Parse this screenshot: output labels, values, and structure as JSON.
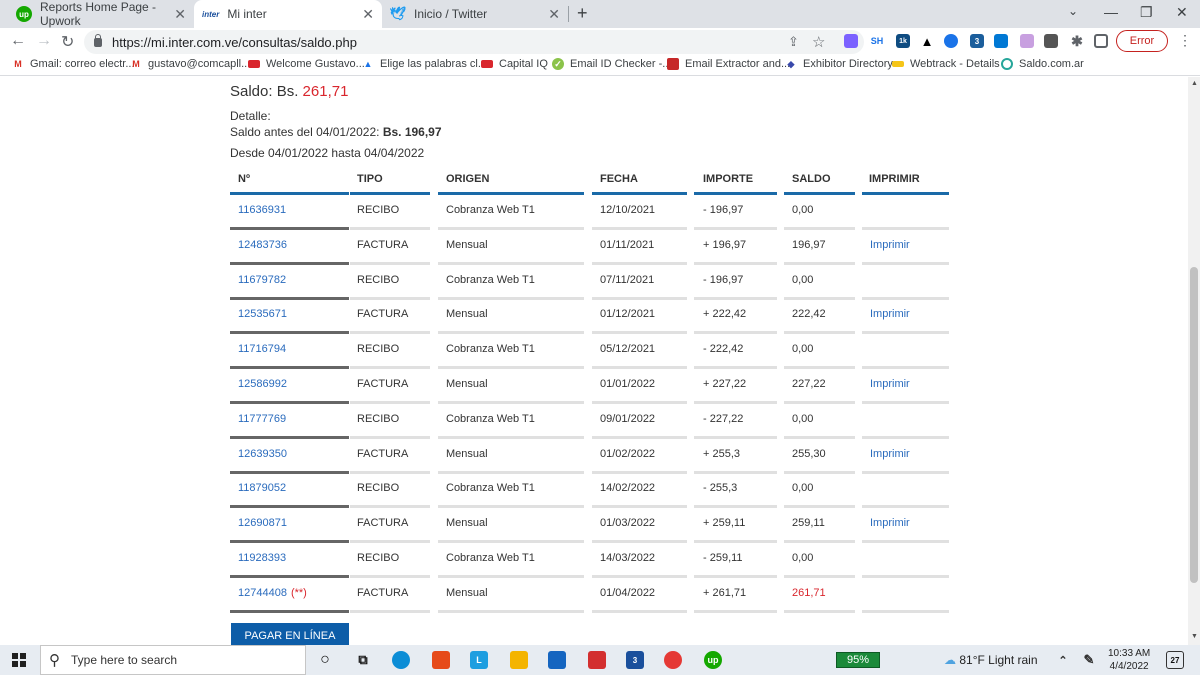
{
  "tabs": [
    {
      "title": "Reports Home Page - Upwork",
      "icon": "upwork-icon",
      "active": false
    },
    {
      "title": "Mi inter",
      "icon": "inter-icon",
      "active": true
    },
    {
      "title": "Inicio / Twitter",
      "icon": "twitter-icon",
      "active": false
    }
  ],
  "inter_favicon_text": "inter",
  "upwork_favicon_text": "up",
  "address": "https://mi.inter.com.ve/consultas/saldo.php",
  "toolbar": {
    "sh_label": "SH",
    "badge_1k": "1k",
    "badge_3": "3",
    "error_label": "Error"
  },
  "bookmarks": [
    {
      "label": "Gmail: correo electr...",
      "icon": "gmail-icon"
    },
    {
      "label": "gustavo@comcapll...",
      "icon": "gmail-icon"
    },
    {
      "label": "Welcome Gustavo...",
      "icon": "flag-icon"
    },
    {
      "label": "Elige las palabras cl...",
      "icon": "google-ads-icon"
    },
    {
      "label": "Capital IQ",
      "icon": "flag-icon"
    },
    {
      "label": "Email ID Checker -...",
      "icon": "checkmark-icon"
    },
    {
      "label": "Email Extractor and...",
      "icon": "extractor-icon"
    },
    {
      "label": "Exhibitor Directory",
      "icon": "exhibitor-icon"
    },
    {
      "label": "Webtrack - Details",
      "icon": "webtrack-icon"
    },
    {
      "label": "Saldo.com.ar",
      "icon": "saldo-icon"
    }
  ],
  "saldo": {
    "label": "Saldo: Bs.",
    "amount": "261,71"
  },
  "detalle_label": "Detalle:",
  "saldo_antes_label": "Saldo antes del 04/01/2022:",
  "saldo_antes_value": "Bs. 196,97",
  "periodo": "Desde 04/01/2022 hasta 04/04/2022",
  "table": {
    "headers": [
      "Nº",
      "TIPO",
      "ORIGEN",
      "FECHA",
      "IMPORTE",
      "SALDO",
      "IMPRIMIR"
    ],
    "rows": [
      {
        "num": "11636931",
        "flag": "",
        "tipo": "RECIBO",
        "origen": "Cobranza Web T1",
        "fecha": "12/10/2021",
        "importe": "- 196,97",
        "saldo": "0,00",
        "imprimir": ""
      },
      {
        "num": "12483736",
        "flag": "",
        "tipo": "FACTURA",
        "origen": "Mensual",
        "fecha": "01/11/2021",
        "importe": "+ 196,97",
        "saldo": "196,97",
        "imprimir": "Imprimir"
      },
      {
        "num": "11679782",
        "flag": "",
        "tipo": "RECIBO",
        "origen": "Cobranza Web T1",
        "fecha": "07/11/2021",
        "importe": "- 196,97",
        "saldo": "0,00",
        "imprimir": ""
      },
      {
        "num": "12535671",
        "flag": "",
        "tipo": "FACTURA",
        "origen": "Mensual",
        "fecha": "01/12/2021",
        "importe": "+ 222,42",
        "saldo": "222,42",
        "imprimir": "Imprimir"
      },
      {
        "num": "11716794",
        "flag": "",
        "tipo": "RECIBO",
        "origen": "Cobranza Web T1",
        "fecha": "05/12/2021",
        "importe": "- 222,42",
        "saldo": "0,00",
        "imprimir": ""
      },
      {
        "num": "12586992",
        "flag": "",
        "tipo": "FACTURA",
        "origen": "Mensual",
        "fecha": "01/01/2022",
        "importe": "+ 227,22",
        "saldo": "227,22",
        "imprimir": "Imprimir"
      },
      {
        "num": "11777769",
        "flag": "",
        "tipo": "RECIBO",
        "origen": "Cobranza Web T1",
        "fecha": "09/01/2022",
        "importe": "- 227,22",
        "saldo": "0,00",
        "imprimir": ""
      },
      {
        "num": "12639350",
        "flag": "",
        "tipo": "FACTURA",
        "origen": "Mensual",
        "fecha": "01/02/2022",
        "importe": "+ 255,3",
        "saldo": "255,30",
        "imprimir": "Imprimir"
      },
      {
        "num": "11879052",
        "flag": "",
        "tipo": "RECIBO",
        "origen": "Cobranza Web T1",
        "fecha": "14/02/2022",
        "importe": "- 255,3",
        "saldo": "0,00",
        "imprimir": ""
      },
      {
        "num": "12690871",
        "flag": "",
        "tipo": "FACTURA",
        "origen": "Mensual",
        "fecha": "01/03/2022",
        "importe": "+ 259,11",
        "saldo": "259,11",
        "imprimir": "Imprimir"
      },
      {
        "num": "11928393",
        "flag": "",
        "tipo": "RECIBO",
        "origen": "Cobranza Web T1",
        "fecha": "14/03/2022",
        "importe": "- 259,11",
        "saldo": "0,00",
        "imprimir": ""
      },
      {
        "num": "12744408",
        "flag": "(**)",
        "tipo": "FACTURA",
        "origen": "Mensual",
        "fecha": "01/04/2022",
        "importe": "+ 261,71",
        "saldo": "261,71",
        "imprimir": ""
      }
    ]
  },
  "pagar_label": "PAGAR EN LÍNEA",
  "colors": {
    "accent": "#1a6aa8",
    "link": "#2a6bbd",
    "alert": "#d9262d",
    "button": "#0d5da8"
  },
  "taskbar": {
    "search_placeholder": "Type here to search",
    "battery": "95%",
    "weather": "81°F  Light rain",
    "time": "10:33 AM",
    "date": "4/4/2022",
    "mail_badge": "3",
    "notif_badge": "27",
    "l_app": "L",
    "up_app": "up"
  }
}
